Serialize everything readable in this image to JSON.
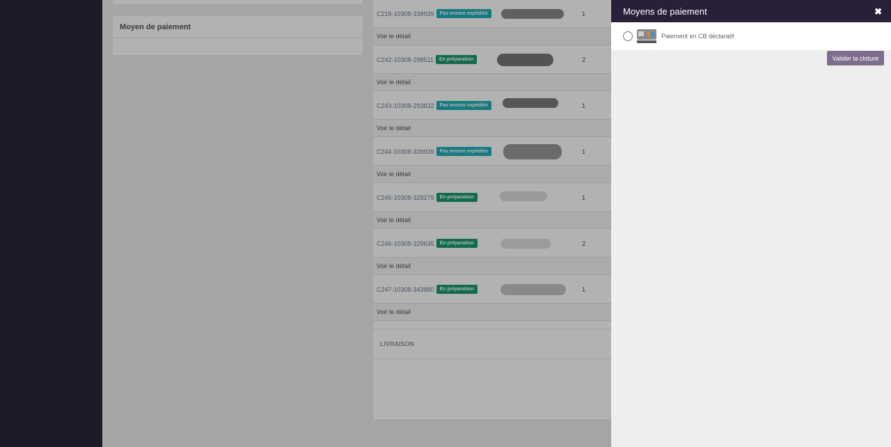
{
  "panel": {
    "title": "Moyens de paiement",
    "close_glyph": "✖",
    "options": [
      {
        "label": "Paiement en CB déclaratif",
        "icon": "credit-card-icon",
        "selected": false
      }
    ],
    "validate_label": "Valider la cloture"
  },
  "left_card": {
    "title": "Moyen de paiement"
  },
  "orders": [
    {
      "ref": "C216-10308-339939",
      "status": "Pas encore expédiée",
      "status_color": "#1fb0b8",
      "qty": "1",
      "detail": "Voir le détail"
    },
    {
      "ref": "C242-10308-298511",
      "status": "En préparation",
      "status_color": "#1a9b6c",
      "qty": "2",
      "detail": "Voir le détail"
    },
    {
      "ref": "C243-10308-293832",
      "status": "Pas encore expédiée",
      "status_color": "#1fb0b8",
      "qty": "1",
      "detail": "Voir le détail"
    },
    {
      "ref": "C244-10308-339939",
      "status": "Pas encore expédiée",
      "status_color": "#1fb0b8",
      "qty": "1",
      "detail": "Voir le détail"
    },
    {
      "ref": "C245-10308-328279",
      "status": "En préparation",
      "status_color": "#1a9b6c",
      "qty": "1",
      "detail": "Voir le détail"
    },
    {
      "ref": "C246-10308-329635",
      "status": "En préparation",
      "status_color": "#1a9b6c",
      "qty": "2",
      "detail": "Voir le détail"
    },
    {
      "ref": "C247-10308-343880",
      "status": "En préparation",
      "status_color": "#1a9b6c",
      "qty": "1",
      "detail": "Voir le détail"
    }
  ],
  "livraison": "LIVRAISON",
  "colors": {
    "panel_header": "#2a1f38",
    "accent_button": "#7f6d8e",
    "sidebar": "#1f1a28"
  }
}
